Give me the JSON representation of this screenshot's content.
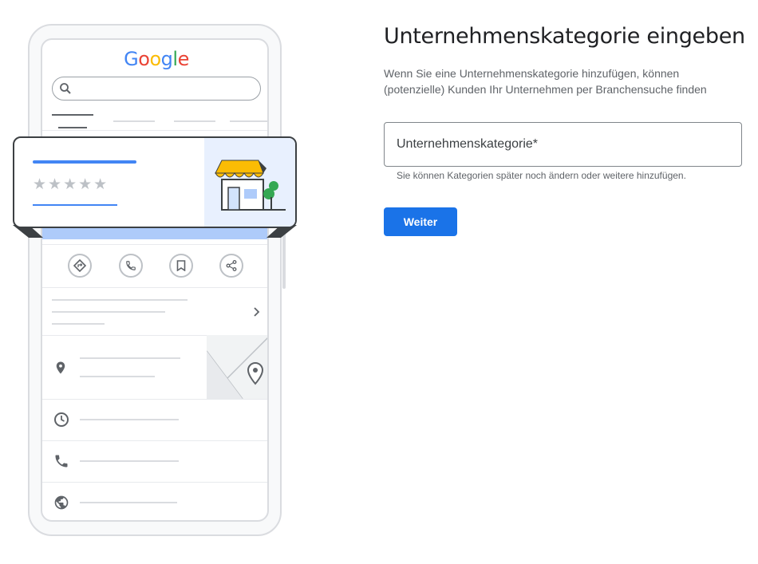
{
  "illustration": {
    "brand": "Google",
    "brand_letters": [
      {
        "ch": "G",
        "color": "#4285f4"
      },
      {
        "ch": "o",
        "color": "#ea4335"
      },
      {
        "ch": "o",
        "color": "#fbbc05"
      },
      {
        "ch": "g",
        "color": "#4285f4"
      },
      {
        "ch": "l",
        "color": "#34a853"
      },
      {
        "ch": "e",
        "color": "#ea4335"
      }
    ],
    "rating_stars": "★★★★★",
    "action_icons": [
      "directions-icon",
      "call-icon",
      "bookmark-icon",
      "share-icon"
    ],
    "info_icons": [
      "location-pin-icon",
      "clock-icon",
      "phone-icon",
      "globe-icon"
    ]
  },
  "form": {
    "title": "Unternehmenskategorie eingeben",
    "description": "Wenn Sie eine Unternehmenskategorie hinzufügen, können (potenzielle) Kunden Ihr Unternehmen per Branchensuche finden",
    "field_placeholder": "Unternehmenskategorie*",
    "field_value": "",
    "hint": "Sie können Kategorien später noch ändern oder weitere hinzufügen.",
    "submit_label": "Weiter"
  },
  "colors": {
    "accent": "#1a73e8",
    "awning": "#fbbc04",
    "tree": "#34a853",
    "card_bg": "#e8f0fe"
  }
}
